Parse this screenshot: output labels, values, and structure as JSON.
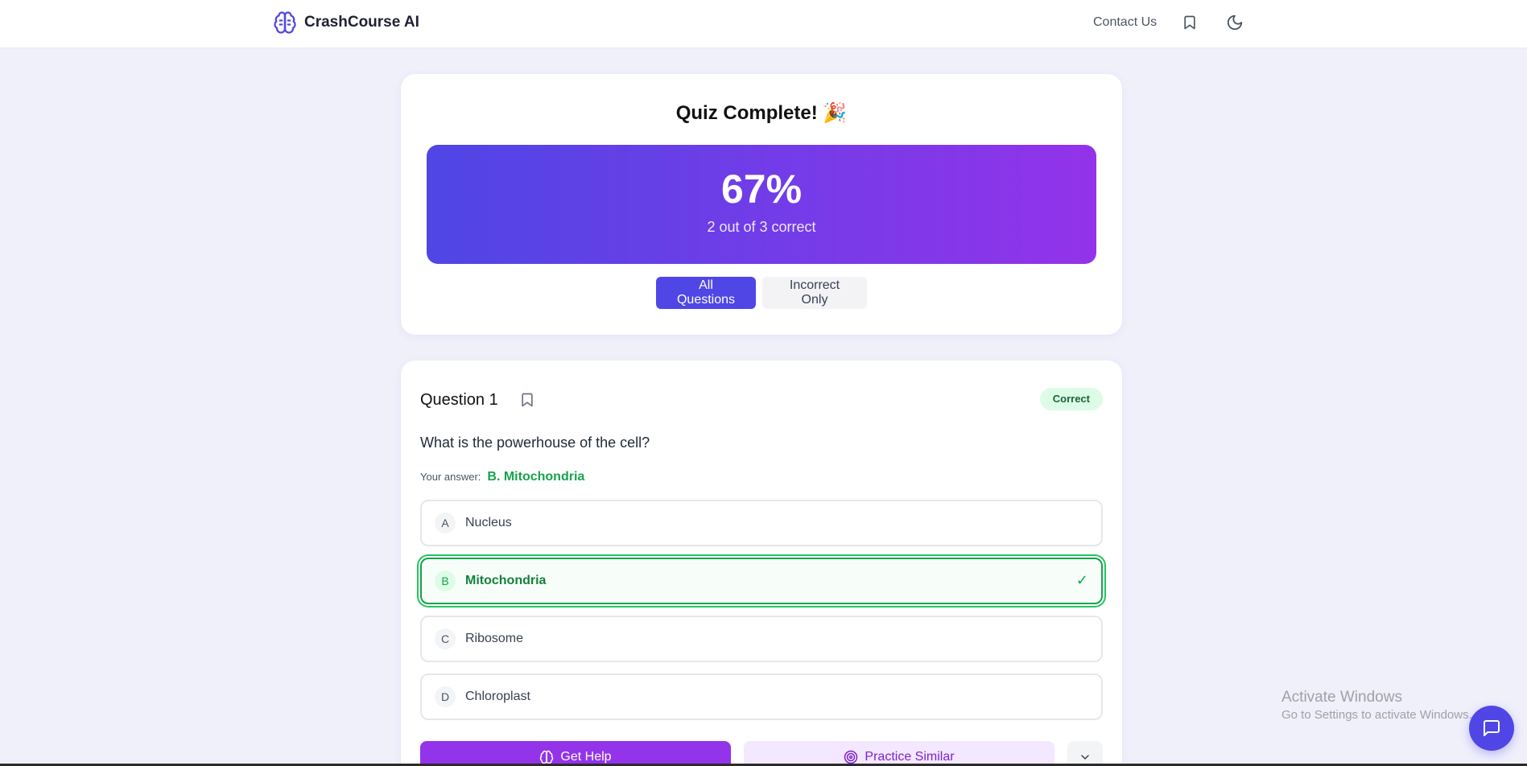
{
  "header": {
    "brand_name": "CrashCourse AI",
    "brand_icon": "brain-icon",
    "contact_label": "Contact Us",
    "bookmark_icon": "bookmark-icon",
    "theme_icon": "moon-icon"
  },
  "score": {
    "title": "Quiz Complete! 🎉",
    "percent": "67%",
    "summary": "2 out of 3 correct",
    "filters": [
      {
        "label": "All Questions",
        "active": true
      },
      {
        "label": "Incorrect Only",
        "active": false
      }
    ]
  },
  "question": {
    "title": "Question 1",
    "status": "Correct",
    "text": "What is the powerhouse of the cell?",
    "answer_label": "Your answer:",
    "answer_value": "B. Mitochondria",
    "options": [
      {
        "letter": "A",
        "text": "Nucleus",
        "correct": false
      },
      {
        "letter": "B",
        "text": "Mitochondria",
        "correct": true
      },
      {
        "letter": "C",
        "text": "Ribosome",
        "correct": false
      },
      {
        "letter": "D",
        "text": "Chloroplast",
        "correct": false
      }
    ],
    "check_mark": "✓",
    "help_label": "Get Help",
    "practice_label": "Practice Similar"
  },
  "watermark": {
    "line1": "Activate Windows",
    "line2": "Go to Settings to activate Windows."
  },
  "colors": {
    "accent": "#4f46e5",
    "purple": "#9333ea",
    "success": "#16a34a",
    "background": "#f0f0fb"
  }
}
